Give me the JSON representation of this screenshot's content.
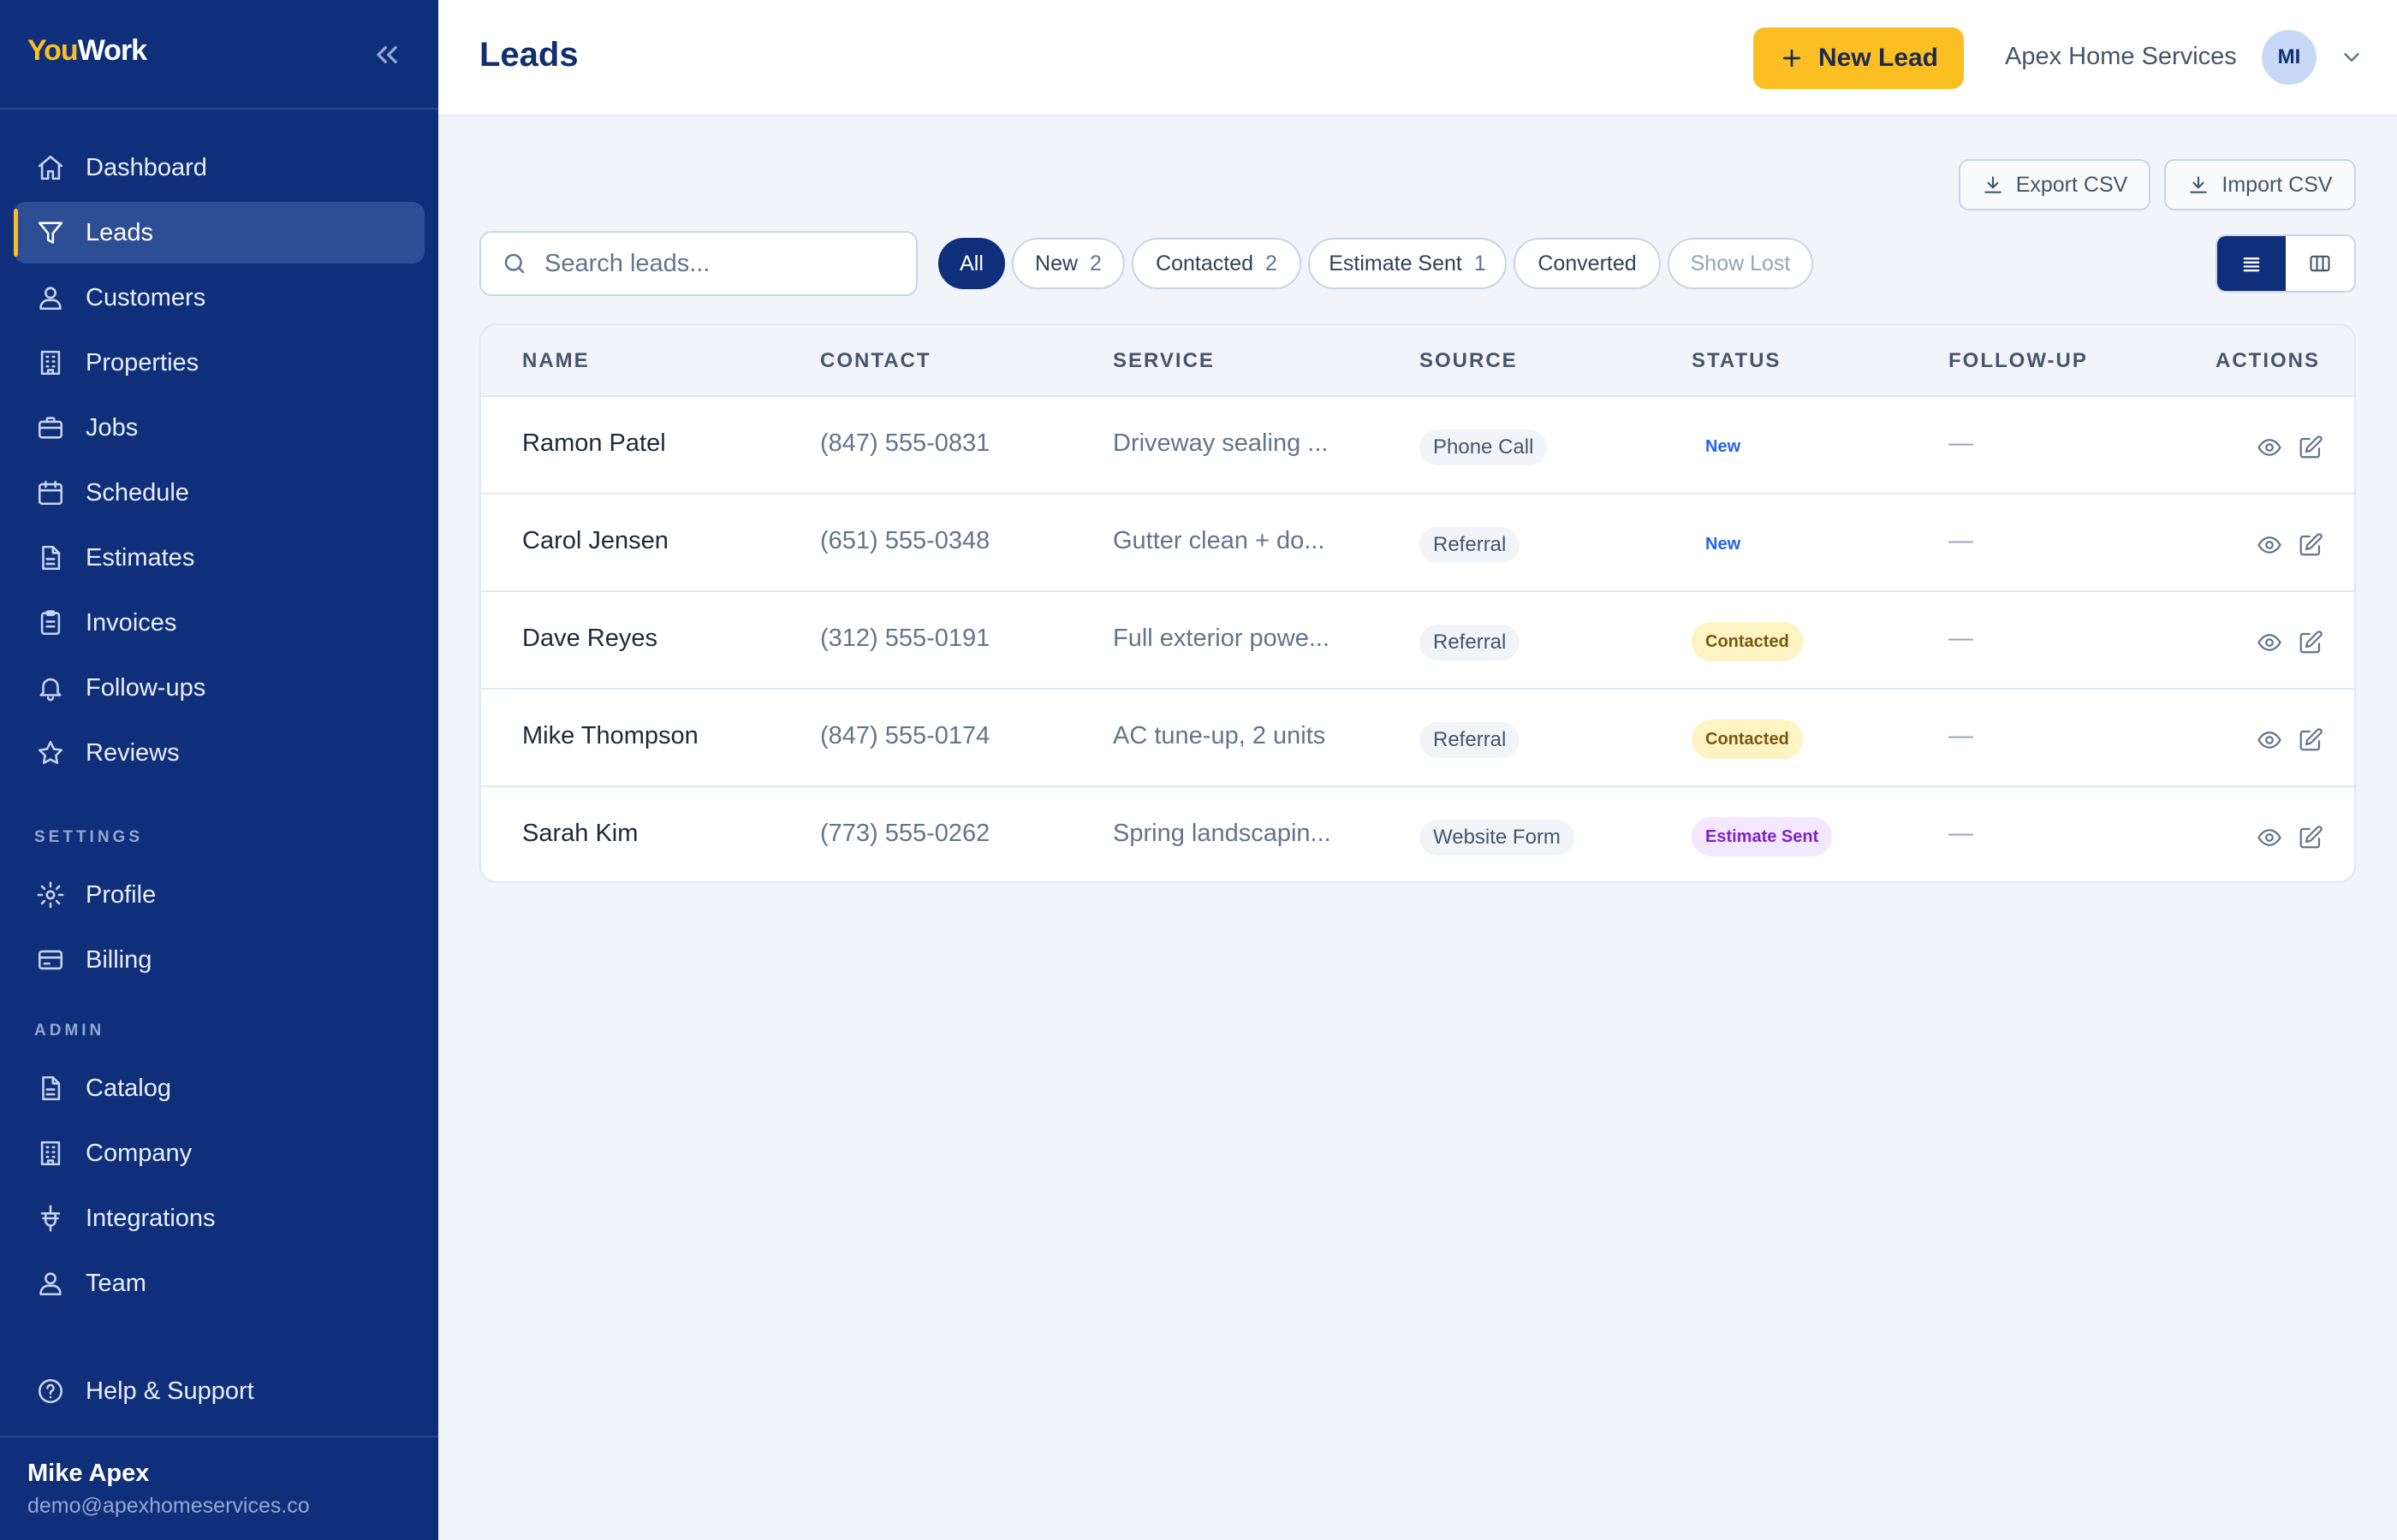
{
  "app": {
    "logo_part1": "You",
    "logo_part2": "Work"
  },
  "sidebar": {
    "items": [
      {
        "label": "Dashboard",
        "icon": "home-icon"
      },
      {
        "label": "Leads",
        "icon": "filter-icon",
        "active": true
      },
      {
        "label": "Customers",
        "icon": "user-icon"
      },
      {
        "label": "Properties",
        "icon": "building-icon"
      },
      {
        "label": "Jobs",
        "icon": "briefcase-icon"
      },
      {
        "label": "Schedule",
        "icon": "calendar-icon"
      },
      {
        "label": "Estimates",
        "icon": "document-icon"
      },
      {
        "label": "Invoices",
        "icon": "clipboard-icon"
      },
      {
        "label": "Follow-ups",
        "icon": "bell-icon"
      },
      {
        "label": "Reviews",
        "icon": "star-icon"
      }
    ],
    "settings_label": "SETTINGS",
    "settings_items": [
      {
        "label": "Profile",
        "icon": "gear-icon"
      },
      {
        "label": "Billing",
        "icon": "credit-card-icon"
      }
    ],
    "admin_label": "ADMIN",
    "admin_items": [
      {
        "label": "Catalog",
        "icon": "document-icon"
      },
      {
        "label": "Company",
        "icon": "building-icon"
      },
      {
        "label": "Integrations",
        "icon": "plug-icon"
      },
      {
        "label": "Team",
        "icon": "user-icon"
      }
    ],
    "help_label": "Help & Support",
    "user": {
      "name": "Mike Apex",
      "email": "demo@apexhomeservices.co"
    }
  },
  "header": {
    "title": "Leads",
    "new_lead_label": "New Lead",
    "company": "Apex Home Services",
    "avatar_initials": "MI"
  },
  "toolbar": {
    "export_label": "Export CSV",
    "import_label": "Import CSV",
    "search_placeholder": "Search leads...",
    "filters": [
      {
        "label": "All",
        "count": "",
        "active": true
      },
      {
        "label": "New",
        "count": "2"
      },
      {
        "label": "Contacted",
        "count": "2"
      },
      {
        "label": "Estimate Sent",
        "count": "1"
      },
      {
        "label": "Converted",
        "count": ""
      },
      {
        "label": "Show Lost",
        "count": ""
      }
    ],
    "view_modes": [
      "list-view",
      "board-view"
    ],
    "active_view": "list-view"
  },
  "table": {
    "columns": [
      "NAME",
      "CONTACT",
      "SERVICE",
      "SOURCE",
      "STATUS",
      "FOLLOW-UP",
      "ACTIONS"
    ],
    "rows": [
      {
        "name": "Ramon Patel",
        "contact": "(847) 555-0831",
        "service": "Driveway sealing ...",
        "source": "Phone Call",
        "status": "New",
        "follow_up": "—"
      },
      {
        "name": "Carol Jensen",
        "contact": "(651) 555-0348",
        "service": "Gutter clean + do...",
        "source": "Referral",
        "status": "New",
        "follow_up": "—"
      },
      {
        "name": "Dave Reyes",
        "contact": "(312) 555-0191",
        "service": "Full exterior powe...",
        "source": "Referral",
        "status": "Contacted",
        "follow_up": "—"
      },
      {
        "name": "Mike Thompson",
        "contact": "(847) 555-0174",
        "service": "AC tune-up, 2 units",
        "source": "Referral",
        "status": "Contacted",
        "follow_up": "—"
      },
      {
        "name": "Sarah Kim",
        "contact": "(773) 555-0262",
        "service": "Spring landscapin...",
        "source": "Website Form",
        "status": "Estimate Sent",
        "follow_up": "—"
      }
    ]
  },
  "colors": {
    "sidebar_bg": "#0f2f7a",
    "accent_yellow": "#fbbf24",
    "status_new": "#2563eb",
    "status_contacted_bg": "#fdf3c3",
    "status_estimate_sent_bg": "#f3e8ff"
  }
}
